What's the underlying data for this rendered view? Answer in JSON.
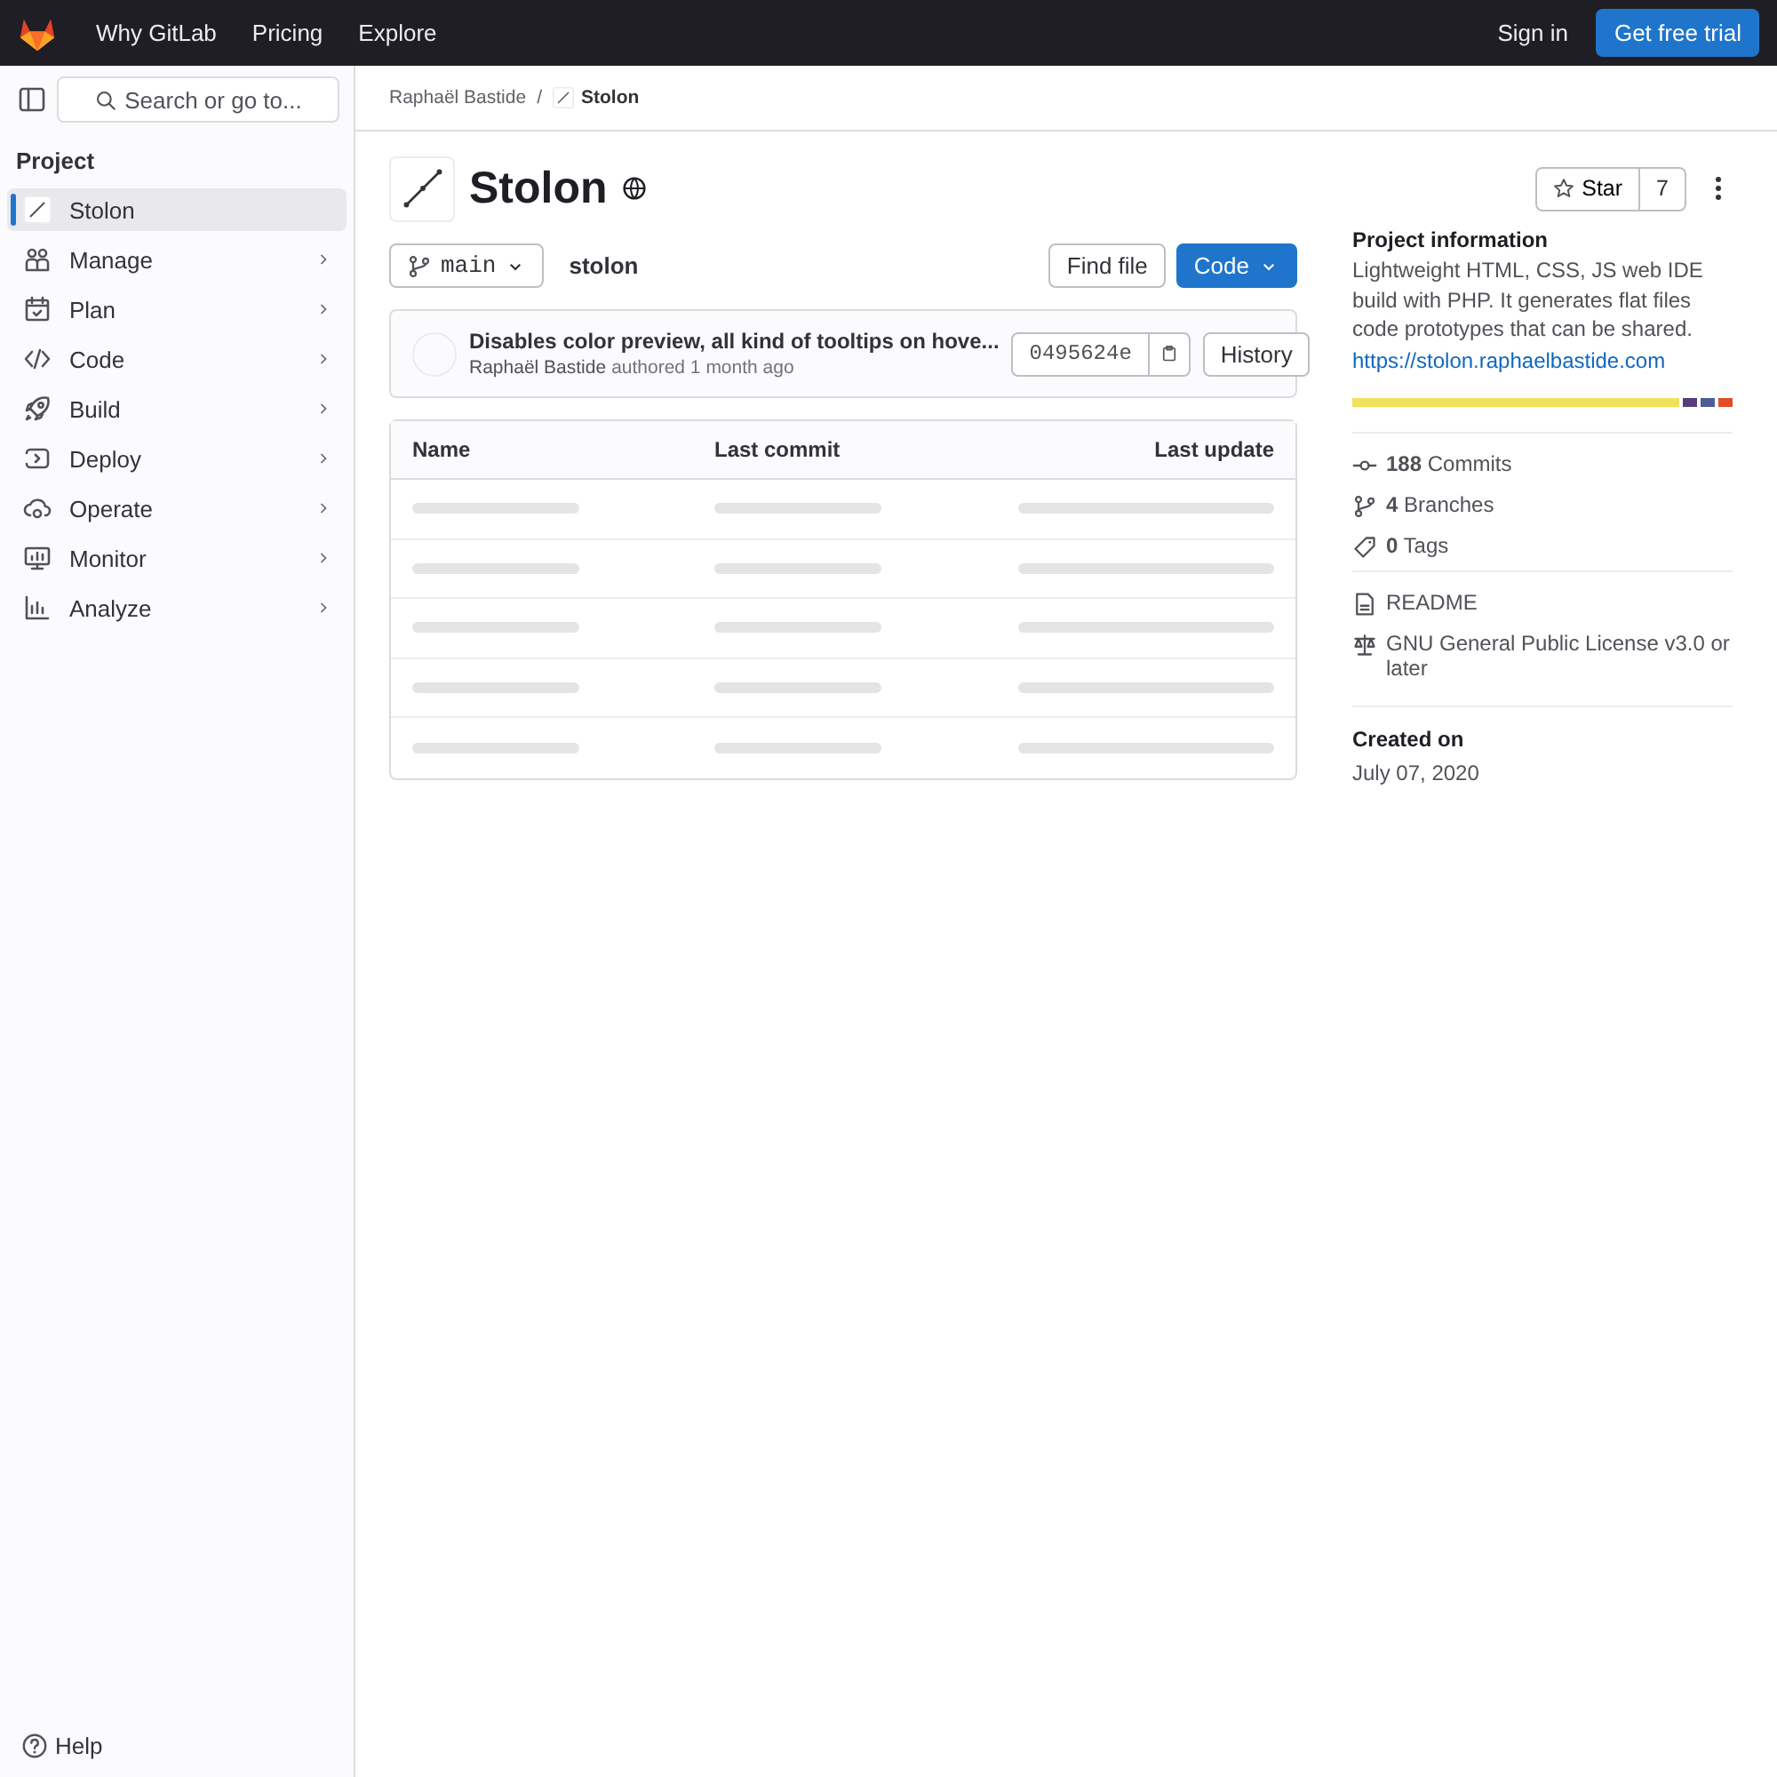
{
  "topbar": {
    "nav": [
      "Why GitLab",
      "Pricing",
      "Explore"
    ],
    "sign_in": "Sign in",
    "trial": "Get free trial"
  },
  "sidebar": {
    "search": {
      "placeholder": "Search or go to..."
    },
    "heading": "Project",
    "items": [
      {
        "label": "Stolon",
        "selected": true,
        "expandable": false
      },
      {
        "label": "Manage",
        "selected": false,
        "expandable": true
      },
      {
        "label": "Plan",
        "selected": false,
        "expandable": true
      },
      {
        "label": "Code",
        "selected": false,
        "expandable": true
      },
      {
        "label": "Build",
        "selected": false,
        "expandable": true
      },
      {
        "label": "Deploy",
        "selected": false,
        "expandable": true
      },
      {
        "label": "Operate",
        "selected": false,
        "expandable": true
      },
      {
        "label": "Monitor",
        "selected": false,
        "expandable": true
      },
      {
        "label": "Analyze",
        "selected": false,
        "expandable": true
      }
    ],
    "help": "Help"
  },
  "breadcrumbs": {
    "separator": "/",
    "items": [
      "Raphaël Bastide",
      "Stolon"
    ]
  },
  "project": {
    "title": "Stolon",
    "star": "Star",
    "star_count": "7"
  },
  "repo": {
    "branch": "main",
    "path": "stolon",
    "find_file": "Find file",
    "code": "Code"
  },
  "last_commit": {
    "message": "Disables color preview, all kind of tooltips on hove...",
    "author": "Raphaël Bastide",
    "meta": "authored 1 month ago",
    "sha": "0495624e",
    "history": "History"
  },
  "table": {
    "columns": [
      "Name",
      "Last commit",
      "Last update"
    ],
    "rows": [
      {
        "kind": "skeleton"
      },
      {
        "kind": "skeleton"
      },
      {
        "kind": "skeleton"
      },
      {
        "kind": "skeleton"
      },
      {
        "kind": "skeleton"
      }
    ]
  },
  "info": {
    "heading": "Project information",
    "description": "Lightweight HTML, CSS, JS web IDE build with PHP. It generates flat files code prototypes that can be shared.",
    "link": "https://stolon.raphaelbastide.com",
    "languages": [
      {
        "color": "#f1e05a"
      },
      {
        "color": "#563d7c"
      },
      {
        "color": "#4f5d95"
      },
      {
        "color": "#e34c26"
      }
    ],
    "stats": [
      "**188** Commits",
      "**4** Branches",
      "**0** Tags"
    ],
    "files": [
      "README",
      "GNU General Public License v3.0 or later"
    ],
    "created_label": "Created on",
    "created": "July 07, 2020"
  }
}
